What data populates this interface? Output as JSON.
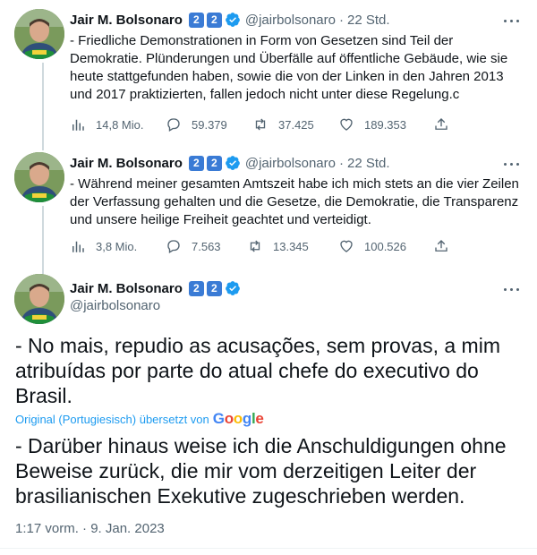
{
  "theme": {
    "accent": "#1d9bf0",
    "text": "#0f1419",
    "muted": "#536471",
    "badge": "#3a7bd5",
    "line": "#cfd9de"
  },
  "tweets": [
    {
      "name": "Jair M. Bolsonaro",
      "badges": [
        "2",
        "2"
      ],
      "handle": "@jairbolsonaro",
      "time": "22 Std.",
      "text": "- Friedliche Demonstrationen in Form von Gesetzen sind Teil der Demokratie. Plünderungen und Überfälle auf öffentliche Gebäude, wie sie heute stattgefunden haben, sowie die von der Linken in den Jahren 2013 und 2017 praktizierten, fallen jedoch nicht unter diese Regelung.c",
      "stats": {
        "views": "14,8 Mio.",
        "replies": "59.379",
        "retweets": "37.425",
        "likes": "189.353"
      }
    },
    {
      "name": "Jair M. Bolsonaro",
      "badges": [
        "2",
        "2"
      ],
      "handle": "@jairbolsonaro",
      "time": "22 Std.",
      "text": "- Während meiner gesamten Amtszeit habe ich mich stets an die vier Zeilen der Verfassung gehalten und die Gesetze, die Demokratie, die Transparenz und unsere heilige Freiheit geachtet und verteidigt.",
      "stats": {
        "views": "3,8 Mio.",
        "replies": "7.563",
        "retweets": "13.345",
        "likes": "100.526"
      }
    }
  ],
  "main_tweet": {
    "name": "Jair M. Bolsonaro",
    "badges": [
      "2",
      "2"
    ],
    "handle": "@jairbolsonaro",
    "original_text": "- No mais, repudio as acusações, sem provas, a mim atribuídas por parte do atual chefe do executivo do Brasil.",
    "translation_note": "Original (Portugiesisch) übersetzt von",
    "translation_provider": "Google",
    "translated_text": "- Darüber hinaus weise ich die Anschuldigungen ohne Beweise zurück, die mir vom derzeitigen Leiter der brasilianischen Exekutive zugeschrieben werden.",
    "timestamp": "1:17 vorm. · 9. Jan. 2023"
  },
  "icons": {
    "views": "bar-chart-icon",
    "reply": "reply-icon",
    "retweet": "retweet-icon",
    "like": "heart-icon",
    "share": "share-icon",
    "more": "more-icon",
    "verified": "verified-icon"
  }
}
